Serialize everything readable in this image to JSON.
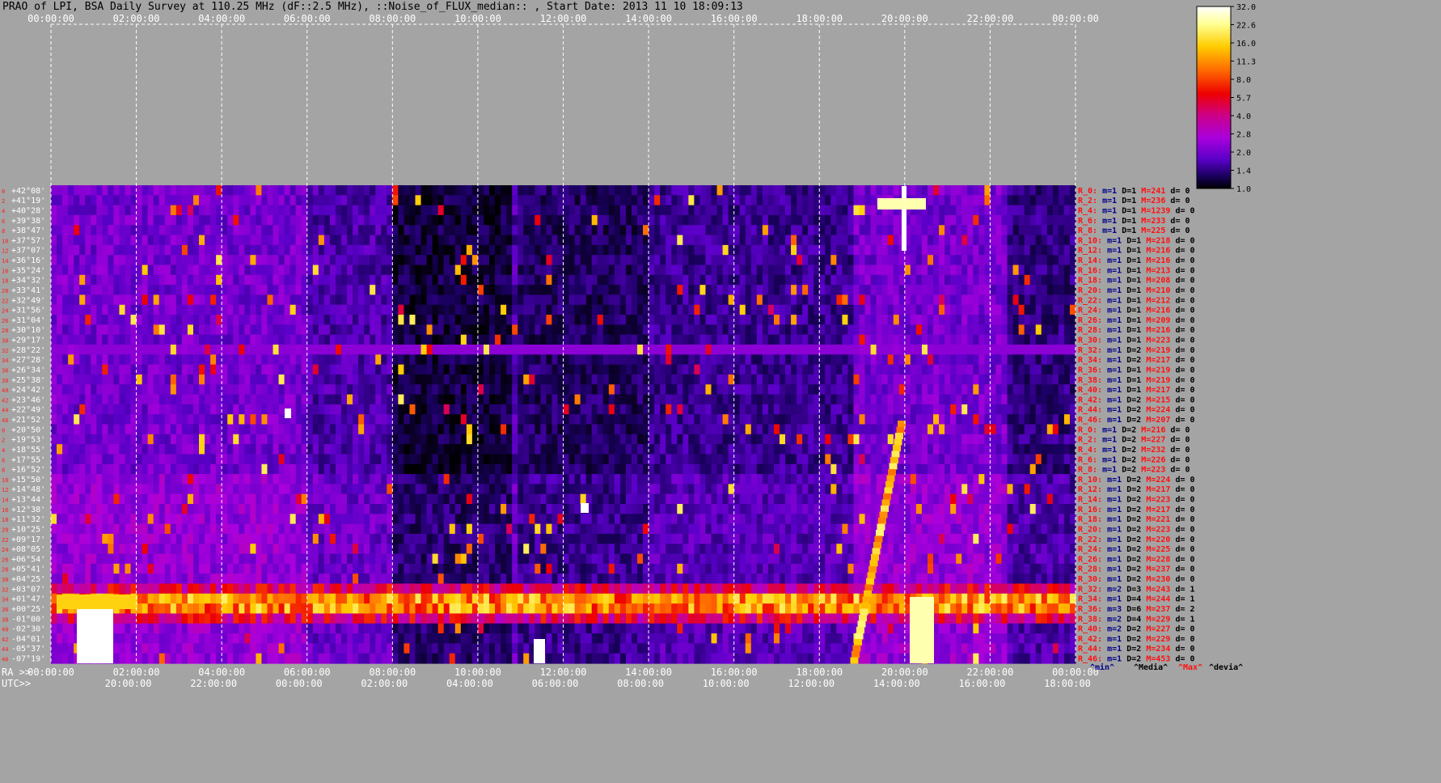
{
  "header": {
    "title": "PRAO of LPI, BSA Daily Survey at 110.25 MHz (dF::2.5 MHz), ::Noise_of_FLUX_median:: , Start Date: 2013 11 10 18:09:13"
  },
  "chart_data": {
    "type": "heatmap",
    "title": "PRAO of LPI, BSA Daily Survey at 110.25 MHz (dF::2.5 MHz), ::Noise_of_FLUX_median:: , Start Date: 2013 11 10 18:09:13",
    "x_top_ticks": [
      "00:00:00",
      "02:00:00",
      "04:00:00",
      "06:00:00",
      "08:00:00",
      "10:00:00",
      "12:00:00",
      "14:00:00",
      "16:00:00",
      "18:00:00",
      "20:00:00",
      "22:00:00",
      "00:00:00"
    ],
    "x_bottom_ra_label": "RA >>",
    "x_bottom_ra_ticks": [
      "00:00:00",
      "02:00:00",
      "04:00:00",
      "06:00:00",
      "08:00:00",
      "10:00:00",
      "12:00:00",
      "14:00:00",
      "16:00:00",
      "18:00:00",
      "20:00:00",
      "22:00:00",
      "00:00:00"
    ],
    "x_bottom_utc_label": "UTC>>",
    "x_bottom_utc_ticks": [
      "20:00:00",
      "22:00:00",
      "00:00:00",
      "02:00:00",
      "04:00:00",
      "06:00:00",
      "08:00:00",
      "10:00:00",
      "12:00:00",
      "14:00:00",
      "16:00:00",
      "18:00:00"
    ],
    "y_ticks": [
      "+42°08'",
      "+41°19'",
      "+40°28'",
      "+39°38'",
      "+38°47'",
      "+37°57'",
      "+37°07'",
      "+36°16'",
      "+35°24'",
      "+34°32'",
      "+33°41'",
      "+32°49'",
      "+31°56'",
      "+31°04'",
      "+30°10'",
      "+29°17'",
      "+28°22'",
      "+27°28'",
      "+26°34'",
      "+25°38'",
      "+24°42'",
      "+23°46'",
      "+22°49'",
      "+21°52'",
      "+20°50'",
      "+19°53'",
      "+18°55'",
      "+17°55'",
      "+16°52'",
      "+15°50'",
      "+14°48'",
      "+13°44'",
      "+12°38'",
      "+11°32'",
      "+10°25'",
      "+09°17'",
      "+08°05'",
      "+06°54'",
      "+05°41'",
      "+04°25'",
      "+03°07'",
      "+01°47'",
      "+00°25'",
      "-01°00'",
      "-02°30'",
      "-04°01'",
      "-05°37'",
      "-07°19'"
    ],
    "colorbar": {
      "ticks": [
        "32.0",
        "22.6",
        "16.0",
        "11.3",
        "8.0",
        "5.7",
        "4.0",
        "2.8",
        "2.0",
        "1.4",
        "1.0"
      ],
      "scale": "log",
      "range": [
        1.0,
        32.0
      ]
    },
    "right_rows": [
      {
        "r": "R_0:",
        "m": "m=1",
        "d": "D=1",
        "mx": "M=241",
        "dv": "d= 0"
      },
      {
        "r": "R_2:",
        "m": "m=1",
        "d": "D=1",
        "mx": "M=236",
        "dv": "d= 0"
      },
      {
        "r": "R_4:",
        "m": "m=1",
        "d": "D=1",
        "mx": "M=1239",
        "dv": "d= 0"
      },
      {
        "r": "R_6:",
        "m": "m=1",
        "d": "D=1",
        "mx": "M=233",
        "dv": "d= 0"
      },
      {
        "r": "R_8:",
        "m": "m=1",
        "d": "D=1",
        "mx": "M=225",
        "dv": "d= 0"
      },
      {
        "r": "R_10:",
        "m": "m=1",
        "d": "D=1",
        "mx": "M=218",
        "dv": "d= 0"
      },
      {
        "r": "R_12:",
        "m": "m=1",
        "d": "D=1",
        "mx": "M=216",
        "dv": "d= 0"
      },
      {
        "r": "R_14:",
        "m": "m=1",
        "d": "D=1",
        "mx": "M=216",
        "dv": "d= 0"
      },
      {
        "r": "R_16:",
        "m": "m=1",
        "d": "D=1",
        "mx": "M=213",
        "dv": "d= 0"
      },
      {
        "r": "R_18:",
        "m": "m=1",
        "d": "D=1",
        "mx": "M=208",
        "dv": "d= 0"
      },
      {
        "r": "R_20:",
        "m": "m=1",
        "d": "D=1",
        "mx": "M=210",
        "dv": "d= 0"
      },
      {
        "r": "R_22:",
        "m": "m=1",
        "d": "D=1",
        "mx": "M=212",
        "dv": "d= 0"
      },
      {
        "r": "R_24:",
        "m": "m=1",
        "d": "D=1",
        "mx": "M=216",
        "dv": "d= 0"
      },
      {
        "r": "R_26:",
        "m": "m=1",
        "d": "D=1",
        "mx": "M=209",
        "dv": "d= 0"
      },
      {
        "r": "R_28:",
        "m": "m=1",
        "d": "D=1",
        "mx": "M=216",
        "dv": "d= 0"
      },
      {
        "r": "R_30:",
        "m": "m=1",
        "d": "D=1",
        "mx": "M=223",
        "dv": "d= 0"
      },
      {
        "r": "R_32:",
        "m": "m=1",
        "d": "D=2",
        "mx": "M=219",
        "dv": "d= 0"
      },
      {
        "r": "R_34:",
        "m": "m=1",
        "d": "D=2",
        "mx": "M=217",
        "dv": "d= 0"
      },
      {
        "r": "R_36:",
        "m": "m=1",
        "d": "D=1",
        "mx": "M=219",
        "dv": "d= 0"
      },
      {
        "r": "R_38:",
        "m": "m=1",
        "d": "D=1",
        "mx": "M=219",
        "dv": "d= 0"
      },
      {
        "r": "R_40:",
        "m": "m=1",
        "d": "D=1",
        "mx": "M=217",
        "dv": "d= 0"
      },
      {
        "r": "R_42:",
        "m": "m=1",
        "d": "D=2",
        "mx": "M=215",
        "dv": "d= 0"
      },
      {
        "r": "R_44:",
        "m": "m=1",
        "d": "D=2",
        "mx": "M=224",
        "dv": "d= 0"
      },
      {
        "r": "R_46:",
        "m": "m=1",
        "d": "D=2",
        "mx": "M=207",
        "dv": "d= 0"
      },
      {
        "r": "R_0:",
        "m": "m=1",
        "d": "D=2",
        "mx": "M=216",
        "dv": "d= 0"
      },
      {
        "r": "R_2:",
        "m": "m=1",
        "d": "D=2",
        "mx": "M=227",
        "dv": "d= 0"
      },
      {
        "r": "R_4:",
        "m": "m=1",
        "d": "D=2",
        "mx": "M=232",
        "dv": "d= 0"
      },
      {
        "r": "R_6:",
        "m": "m=1",
        "d": "D=2",
        "mx": "M=226",
        "dv": "d= 0"
      },
      {
        "r": "R_8:",
        "m": "m=1",
        "d": "D=2",
        "mx": "M=223",
        "dv": "d= 0"
      },
      {
        "r": "R_10:",
        "m": "m=1",
        "d": "D=2",
        "mx": "M=224",
        "dv": "d= 0"
      },
      {
        "r": "R_12:",
        "m": "m=1",
        "d": "D=2",
        "mx": "M=217",
        "dv": "d= 0"
      },
      {
        "r": "R_14:",
        "m": "m=1",
        "d": "D=2",
        "mx": "M=223",
        "dv": "d= 0"
      },
      {
        "r": "R_16:",
        "m": "m=1",
        "d": "D=2",
        "mx": "M=217",
        "dv": "d= 0"
      },
      {
        "r": "R_18:",
        "m": "m=1",
        "d": "D=2",
        "mx": "M=221",
        "dv": "d= 0"
      },
      {
        "r": "R_20:",
        "m": "m=1",
        "d": "D=2",
        "mx": "M=223",
        "dv": "d= 0"
      },
      {
        "r": "R_22:",
        "m": "m=1",
        "d": "D=2",
        "mx": "M=220",
        "dv": "d= 0"
      },
      {
        "r": "R_24:",
        "m": "m=1",
        "d": "D=2",
        "mx": "M=225",
        "dv": "d= 0"
      },
      {
        "r": "R_26:",
        "m": "m=1",
        "d": "D=2",
        "mx": "M=228",
        "dv": "d= 0"
      },
      {
        "r": "R_28:",
        "m": "m=1",
        "d": "D=2",
        "mx": "M=237",
        "dv": "d= 0"
      },
      {
        "r": "R_30:",
        "m": "m=1",
        "d": "D=2",
        "mx": "M=230",
        "dv": "d= 0"
      },
      {
        "r": "R_32:",
        "m": "m=2",
        "d": "D=3",
        "mx": "M=243",
        "dv": "d= 1"
      },
      {
        "r": "R_34:",
        "m": "m=1",
        "d": "D=4",
        "mx": "M=244",
        "dv": "d= 1"
      },
      {
        "r": "R_36:",
        "m": "m=3",
        "d": "D=6",
        "mx": "M=237",
        "dv": "d= 2"
      },
      {
        "r": "R_38:",
        "m": "m=2",
        "d": "D=4",
        "mx": "M=229",
        "dv": "d= 1"
      },
      {
        "r": "R_40:",
        "m": "m=2",
        "d": "D=2",
        "mx": "M=227",
        "dv": "d= 0"
      },
      {
        "r": "R_42:",
        "m": "m=1",
        "d": "D=2",
        "mx": "M=229",
        "dv": "d= 0"
      },
      {
        "r": "R_44:",
        "m": "m=1",
        "d": "D=2",
        "mx": "M=234",
        "dv": "d= 0"
      },
      {
        "r": "R_46:",
        "m": "m=1",
        "d": "D=2",
        "mx": "M=453",
        "dv": "d= 0"
      }
    ],
    "right_footer": [
      "^min^",
      "^Media^",
      "^Max^",
      "^devia^"
    ]
  },
  "colors": {
    "background": "#a4a4a4",
    "label_red": "#ff1010",
    "label_blue": "#00008b",
    "label_black": "#000000"
  }
}
